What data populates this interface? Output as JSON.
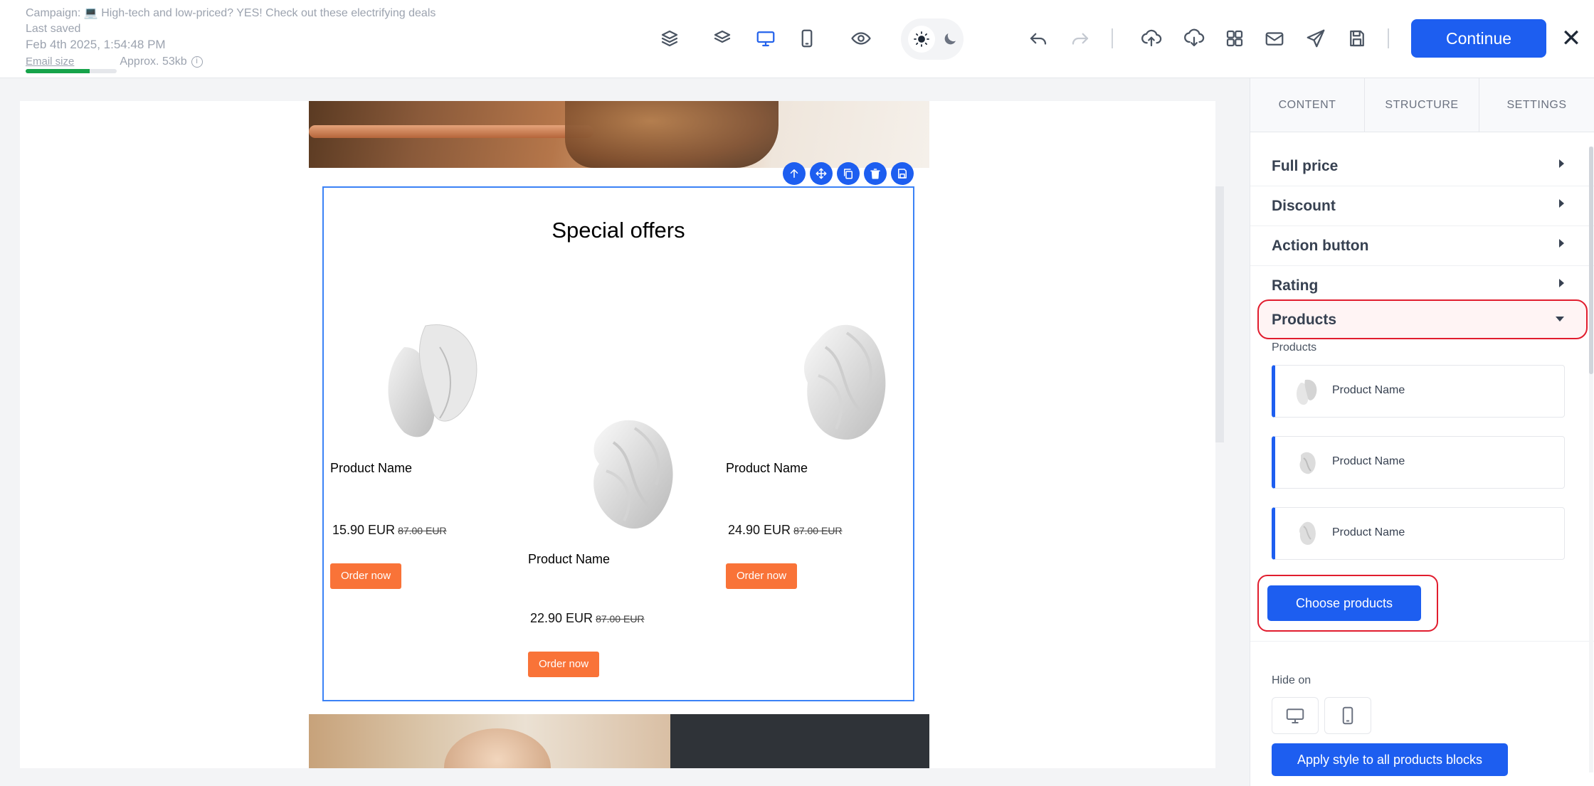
{
  "header": {
    "campaign_prefix": "Campaign:",
    "campaign_emoji": "💻",
    "campaign_name": "High-tech and low-priced? YES! Check out these electrifying deals",
    "last_saved_label": "Last saved",
    "last_saved_date": "Feb 4th 2025, 1:54:48 PM",
    "email_size_label": "Email size",
    "email_size_value": "Approx. 53kb",
    "email_size_fraction": 0.7,
    "email_size_color": "#16a34a"
  },
  "toolbar": {
    "continue_label": "Continue",
    "accent_color": "#1d5ef0",
    "active_view": "desktop"
  },
  "email": {
    "section_title": "Special offers",
    "products": [
      {
        "name": "Product Name",
        "price": "15.90 EUR",
        "old_price": "87.00 EUR",
        "button": "Order now"
      },
      {
        "name": "Product Name",
        "price": "22.90 EUR",
        "old_price": "87.00 EUR",
        "button": "Order now"
      },
      {
        "name": "Product Name",
        "price": "24.90 EUR",
        "old_price": "87.00 EUR",
        "button": "Order now"
      }
    ],
    "order_button_color": "#f97338"
  },
  "panel": {
    "tabs": [
      "CONTENT",
      "STRUCTURE",
      "SETTINGS"
    ],
    "sections": [
      "Full price",
      "Discount",
      "Action button",
      "Rating"
    ],
    "open_section": "Products",
    "products_label": "Products",
    "product_cards": [
      "Product Name",
      "Product Name",
      "Product Name"
    ],
    "choose_products_label": "Choose products",
    "hide_on_label": "Hide on",
    "apply_label": "Apply style to all products blocks",
    "highlight_color": "#e11d2e"
  }
}
